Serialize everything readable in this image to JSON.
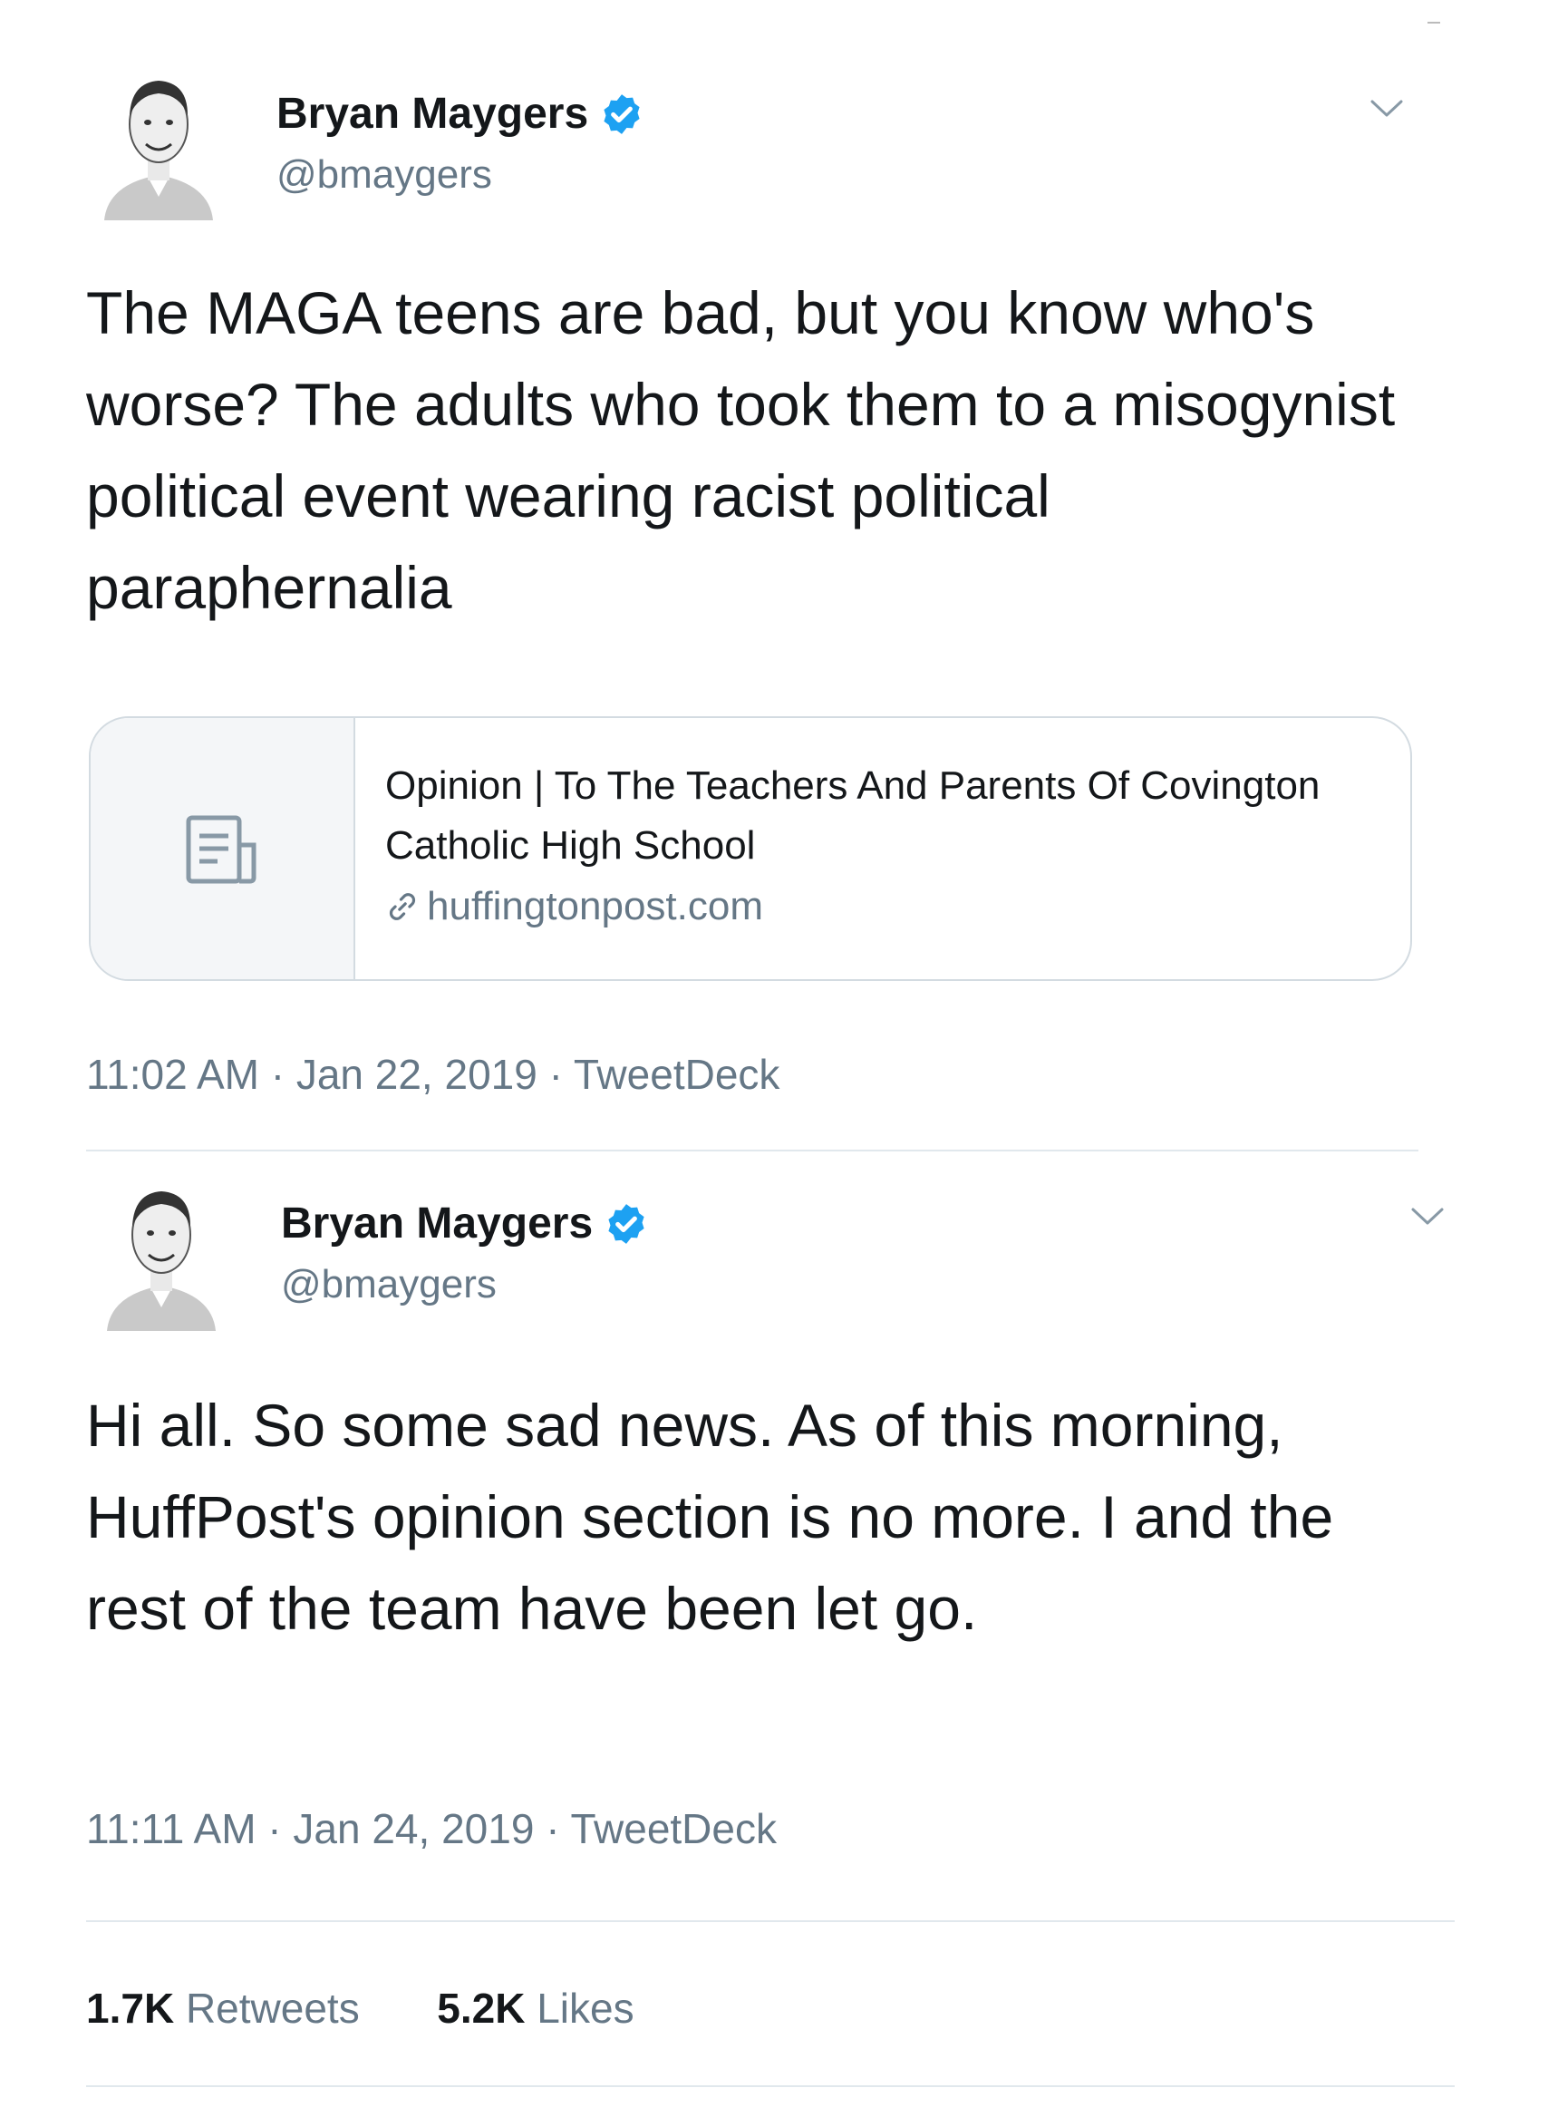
{
  "tweets": [
    {
      "author": {
        "name": "Bryan Maygers",
        "handle": "@bmaygers",
        "verified": true
      },
      "text": "The MAGA teens are bad, but you know who's worse? The adults who took them to a misogynist political event wearing racist political paraphernalia",
      "link_card": {
        "title": "Opinion | To The Teachers And Parents Of Covington Catholic High School",
        "domain": "huffingtonpost.com",
        "icon": "document-icon"
      },
      "timestamp": "11:02 AM · Jan 22, 2019 · TweetDeck"
    },
    {
      "author": {
        "name": "Bryan Maygers",
        "handle": "@bmaygers",
        "verified": true
      },
      "text": "Hi all. So some sad news. As of this morning, HuffPost's opinion section is no more. I and the rest of the team have been let go.",
      "timestamp": "11:11 AM · Jan 24, 2019 · TweetDeck",
      "stats": {
        "retweets_count": "1.7K",
        "retweets_label": "Retweets",
        "likes_count": "5.2K",
        "likes_label": "Likes"
      }
    }
  ],
  "colors": {
    "verified_badge": "#1da1f2",
    "secondary_text": "#657786",
    "divider": "#e1e8ed"
  }
}
